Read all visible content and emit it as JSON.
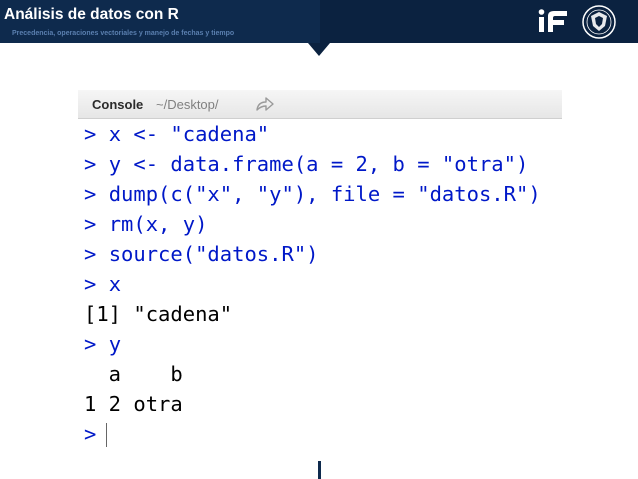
{
  "header": {
    "title": "Análisis de datos con R",
    "subtitle": "Precedencia, operaciones vectoriales y manejo de fechas y tiempo",
    "logos": [
      "if-logo",
      "unam-seal"
    ],
    "colors": {
      "banner": "#0b2240",
      "subtitle": "#5a7faf"
    }
  },
  "console": {
    "label": "Console",
    "path": "~/Desktop/",
    "icon": "go-to-directory-arrow-icon",
    "colors": {
      "input": "#0018c8",
      "output": "#000000"
    },
    "lines": [
      {
        "prompt": "> ",
        "text": "x <- \"cadena\""
      },
      {
        "prompt": "> ",
        "text": "y <- data.frame(a = 2, b = \"otra\")"
      },
      {
        "prompt": "> ",
        "text": "dump(c(\"x\", \"y\"), file = \"datos.R\")"
      },
      {
        "prompt": "> ",
        "text": "rm(x, y)"
      },
      {
        "prompt": "> ",
        "text": "source(\"datos.R\")"
      },
      {
        "prompt": "> ",
        "text": "x"
      },
      {
        "prompt": "",
        "text": "[1] \"cadena\""
      },
      {
        "prompt": "> ",
        "text": "y"
      },
      {
        "prompt": "",
        "text": "  a    b"
      },
      {
        "prompt": "",
        "text": "1 2 otra"
      },
      {
        "prompt": ">",
        "text": ""
      }
    ]
  }
}
